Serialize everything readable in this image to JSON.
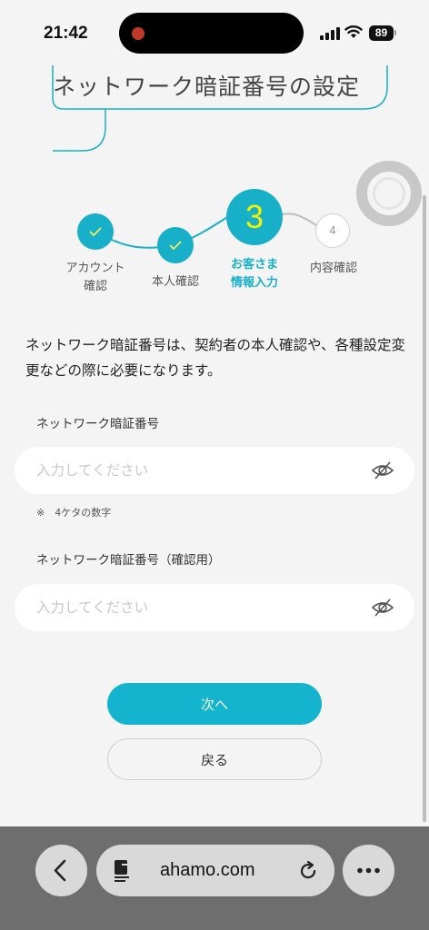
{
  "status_bar": {
    "time": "21:42",
    "battery": "89"
  },
  "page": {
    "title": "ネットワーク暗証番号の設定"
  },
  "stepper": {
    "steps": [
      {
        "number": "",
        "label": "アカウント確認",
        "label_lines": [
          "アカウント",
          "確認"
        ],
        "state": "done"
      },
      {
        "number": "",
        "label": "本人確認",
        "label_lines": [
          "本人確認"
        ],
        "state": "done"
      },
      {
        "number": "3",
        "label": "お客さま情報入力",
        "label_lines": [
          "お客さま",
          "情報入力"
        ],
        "state": "active"
      },
      {
        "number": "4",
        "label": "内容確認",
        "label_lines": [
          "内容確認"
        ],
        "state": "pending"
      }
    ]
  },
  "description": "ネットワーク暗証番号は、契約者の本人確認や、各種設定変更などの際に必要になります。",
  "form": {
    "pin": {
      "label": "ネットワーク暗証番号",
      "placeholder": "入力してください",
      "value": "",
      "hint": "※　4ケタの数字"
    },
    "pin_confirm": {
      "label": "ネットワーク暗証番号（確認用）",
      "placeholder": "入力してください",
      "value": ""
    }
  },
  "buttons": {
    "next": "次へ",
    "back": "戻る"
  },
  "browser": {
    "url": "ahamo.com"
  },
  "colors": {
    "accent": "#14b4cf",
    "active_number": "#f2f200"
  },
  "icons": [
    "check-icon",
    "eye-slash-icon",
    "chevron-left-icon",
    "reader-icon",
    "reload-icon",
    "more-icon"
  ]
}
